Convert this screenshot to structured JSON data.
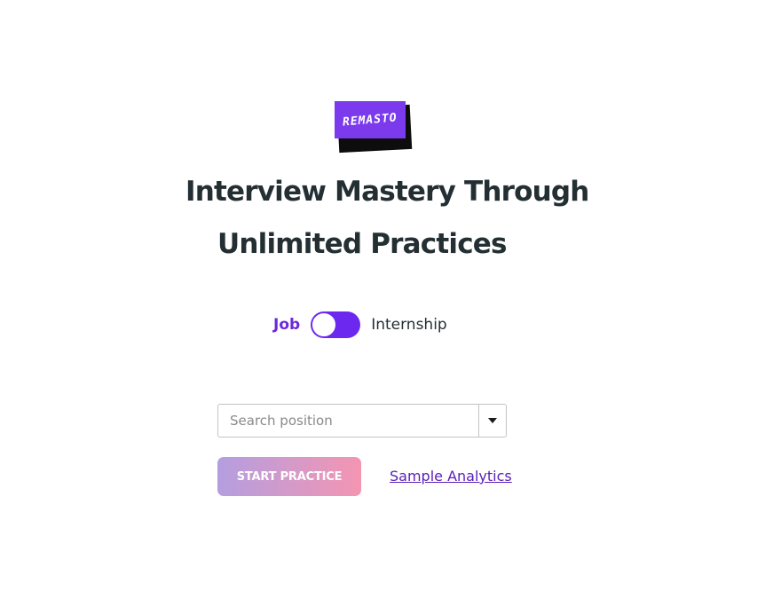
{
  "logo": {
    "text": "REMASTO",
    "colors": {
      "front": "#7c3aed",
      "shadow": "#0d0d0d",
      "text": "#ffffff"
    }
  },
  "hero": {
    "title_line_1": "Interview Mastery Through",
    "title_line_2": "Unlimited Practices"
  },
  "mode_toggle": {
    "left_label": "Job",
    "right_label": "Internship",
    "selected": "Job",
    "colors": {
      "active": "#6d28d9",
      "track": "#6d28f0"
    }
  },
  "search": {
    "placeholder": "Search position",
    "value": ""
  },
  "actions": {
    "start_label": "START PRACTICE",
    "sample_link_label": "Sample Analytics"
  },
  "colors": {
    "text": "#242f33",
    "link": "#5b21b6",
    "button_gradient_start": "#b49ee0",
    "button_gradient_end": "#f495b2"
  }
}
